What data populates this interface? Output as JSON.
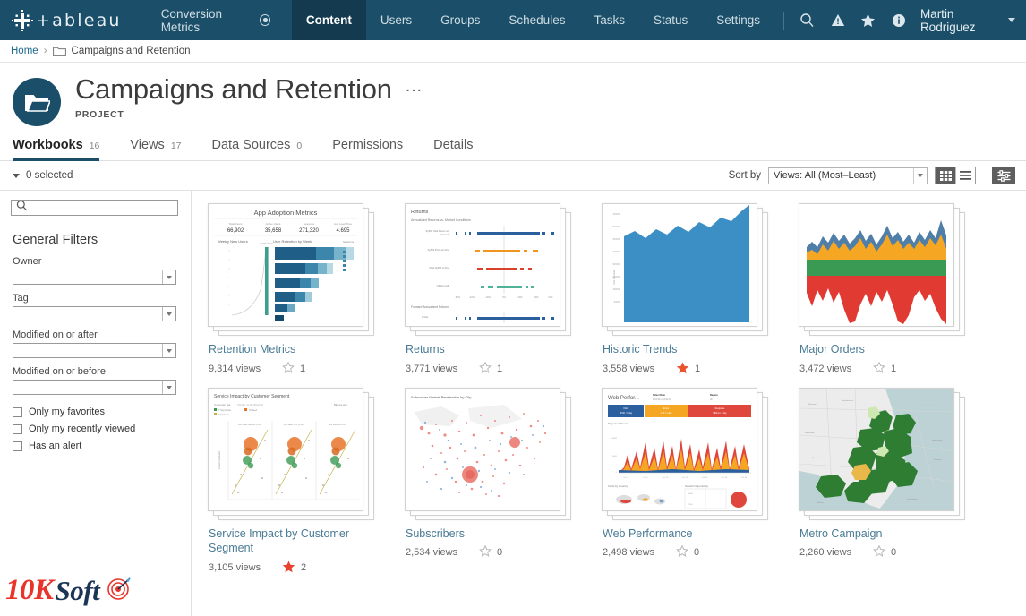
{
  "topnav": {
    "logo_text": "+ableau",
    "logo_icon": "tableau-logo-icon",
    "site_name": "Conversion Metrics",
    "site_icon": "site-selector-icon",
    "links": [
      {
        "label": "Content",
        "active": true
      },
      {
        "label": "Users",
        "active": false
      },
      {
        "label": "Groups",
        "active": false
      },
      {
        "label": "Schedules",
        "active": false
      },
      {
        "label": "Tasks",
        "active": false
      },
      {
        "label": "Status",
        "active": false
      },
      {
        "label": "Settings",
        "active": false
      }
    ],
    "icons": [
      "search-icon",
      "alerts-icon",
      "favorites-icon",
      "help-icon"
    ],
    "user_name": "Martin Rodriguez"
  },
  "breadcrumb": {
    "home": "Home",
    "separator": "›",
    "folder_icon": "folder-icon",
    "current": "Campaigns and Retention"
  },
  "project": {
    "avatar_icon": "project-folder-icon",
    "title": "Campaigns and Retention",
    "more_label": "…",
    "subtitle": "PROJECT"
  },
  "tabs": [
    {
      "label": "Workbooks",
      "count": "16",
      "active": true
    },
    {
      "label": "Views",
      "count": "17",
      "active": false
    },
    {
      "label": "Data Sources",
      "count": "0",
      "active": false
    },
    {
      "label": "Permissions",
      "count": "",
      "active": false
    },
    {
      "label": "Details",
      "count": "",
      "active": false
    }
  ],
  "toolbar": {
    "selected_label": "0 selected",
    "sort_by_label": "Sort by",
    "sort_value": "Views: All (Most–Least)",
    "sort_options": [
      "Views: All (Most–Least)"
    ],
    "grid_view_icon": "grid-view-icon",
    "list_view_icon": "list-view-icon",
    "filter_icon": "filter-settings-icon",
    "grid_active": true
  },
  "sidebar": {
    "search_placeholder": "",
    "search_value": "",
    "search_icon": "search-icon",
    "heading": "General Filters",
    "fields": [
      {
        "label": "Owner",
        "value": ""
      },
      {
        "label": "Tag",
        "value": ""
      },
      {
        "label": "Modified on or after",
        "value": ""
      },
      {
        "label": "Modified on or before",
        "value": ""
      }
    ],
    "checkboxes": [
      {
        "label": "Only my favorites",
        "checked": false
      },
      {
        "label": "Only my recently viewed",
        "checked": false
      },
      {
        "label": "Has an alert",
        "checked": false
      }
    ]
  },
  "cards": [
    {
      "title": "Retention Metrics",
      "views": "9,314 views",
      "favorites": "1",
      "favorited": false,
      "thumb": "retention-metrics-thumbnail",
      "thumb_title": "App Adoption Metrics"
    },
    {
      "title": "Returns",
      "views": "3,771 views",
      "favorites": "1",
      "favorited": false,
      "thumb": "returns-thumbnail",
      "thumb_title": "Returns"
    },
    {
      "title": "Historic Trends",
      "views": "3,558 views",
      "favorites": "1",
      "favorited": true,
      "thumb": "historic-trends-thumbnail",
      "thumb_title": ""
    },
    {
      "title": "Major Orders",
      "views": "3,472 views",
      "favorites": "1",
      "favorited": false,
      "thumb": "major-orders-thumbnail",
      "thumb_title": ""
    },
    {
      "title": "Service Impact by Customer Segment",
      "views": "3,105 views",
      "favorites": "2",
      "favorited": true,
      "thumb": "service-impact-thumbnail",
      "thumb_title": "Service Impact by Customer Segment"
    },
    {
      "title": "Subscribers",
      "views": "2,534 views",
      "favorites": "0",
      "favorited": false,
      "thumb": "subscribers-thumbnail",
      "thumb_title": "Subscriber Market Penetration by City"
    },
    {
      "title": "Web Performance",
      "views": "2,498 views",
      "favorites": "0",
      "favorited": false,
      "thumb": "web-performance-thumbnail",
      "thumb_title": "Web Perfor..."
    },
    {
      "title": "Metro Campaign",
      "views": "2,260 views",
      "favorites": "0",
      "favorited": false,
      "thumb": "metro-campaign-thumbnail",
      "thumb_title": ""
    }
  ],
  "watermark": {
    "part1": "10K",
    "part2": "Soft",
    "icon": "target-icon"
  },
  "colors": {
    "nav_bg": "#1b4e68",
    "nav_active_bg": "#143a50",
    "link_blue": "#4a7b95",
    "favorite_orange": "#e8542f",
    "tab_underline": "#1b4e68"
  }
}
